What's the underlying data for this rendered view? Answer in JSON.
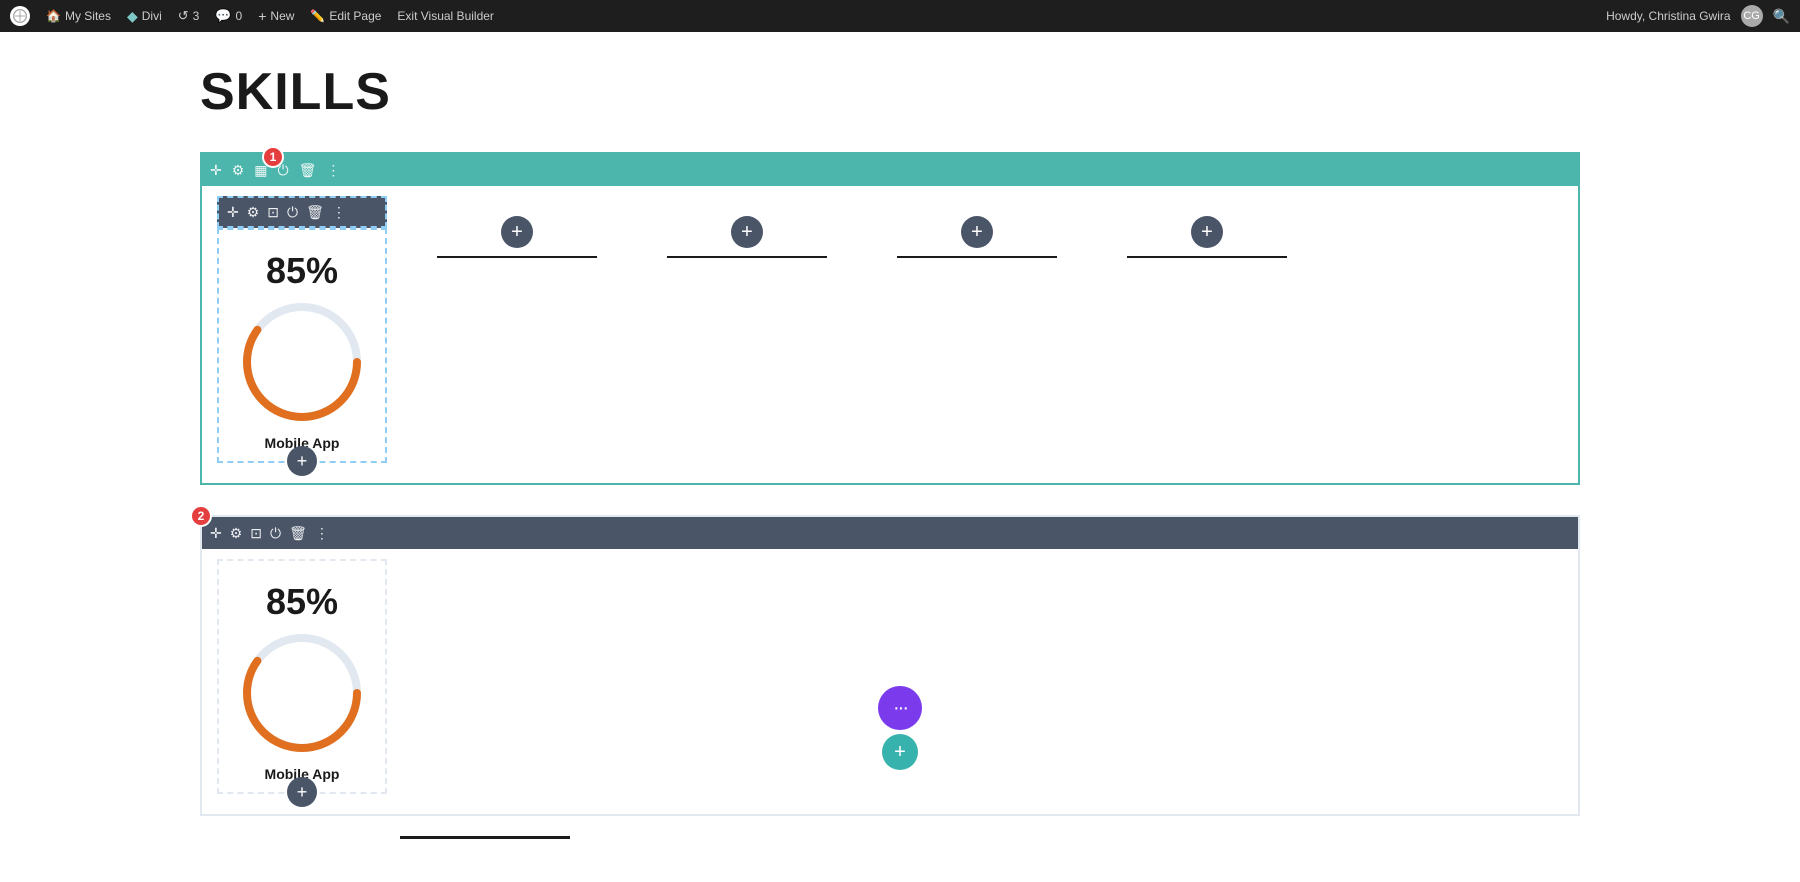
{
  "adminBar": {
    "wpLogoAlt": "WordPress",
    "mySites": "My Sites",
    "divi": "Divi",
    "revisions": "3",
    "comments": "0",
    "new": "New",
    "editPage": "Edit Page",
    "exitVisualBuilder": "Exit Visual Builder",
    "howdy": "Howdy, Christina Gwira",
    "searchIcon": "search"
  },
  "page": {
    "title": "SKILLS"
  },
  "toolbar1": {
    "badge": "1",
    "icons": [
      "move",
      "settings",
      "grid",
      "power",
      "trash",
      "more"
    ]
  },
  "toolbar2": {
    "icons": [
      "move",
      "settings",
      "resize",
      "power",
      "trash",
      "more"
    ]
  },
  "modules": {
    "module1": {
      "percentage": "85%",
      "label": "Mobile App"
    },
    "module2": {
      "percentage": "85%",
      "label": "Mobile App"
    }
  },
  "columns": [
    {
      "id": "col2"
    },
    {
      "id": "col3"
    },
    {
      "id": "col4"
    },
    {
      "id": "col5"
    }
  ],
  "bottomButtons": {
    "moreOptions": "⋯",
    "addSection": "+"
  },
  "badge2": "2"
}
